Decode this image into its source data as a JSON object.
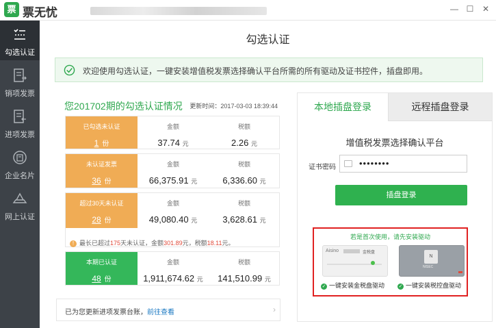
{
  "app": {
    "logo_char": "票",
    "title": "票无忧",
    "minimize": "—",
    "maximize": "☐",
    "close": "✕"
  },
  "sidebar": {
    "items": [
      {
        "label": "勾选认证",
        "icon": "check-list-icon",
        "active": true
      },
      {
        "label": "销项发票",
        "icon": "output-invoice-icon",
        "active": false
      },
      {
        "label": "进项发票",
        "icon": "input-invoice-icon",
        "active": false
      },
      {
        "label": "企业名片",
        "icon": "company-card-icon",
        "active": false
      },
      {
        "label": "网上认证",
        "icon": "online-auth-icon",
        "active": false
      }
    ]
  },
  "main": {
    "title": "勾选认证",
    "notice": "欢迎使用勾选认证，一键安装增值税发票选择确认平台所需的所有驱动及证书控件，插盘即用。"
  },
  "stats": {
    "title": "您201702期的勾选认证情况",
    "update_time": "更新时间：2017-03-03 18:39:44",
    "col_amount": "金额",
    "col_tax": "税额",
    "unit_yuan": "元",
    "unit_fen": "份",
    "rows": [
      {
        "label": "已勾选未认证",
        "count": "1",
        "amount": "37.74",
        "tax": "2.26",
        "color": "#f0ac55"
      },
      {
        "label": "未认证发票",
        "count": "36",
        "amount": "66,375.91",
        "tax": "6,336.60",
        "color": "#f0ac55"
      },
      {
        "label": "超过30天未认证",
        "count": "28",
        "amount": "49,080.40",
        "tax": "3,628.61",
        "color": "#f0ac55"
      },
      {
        "label": "本期已认证",
        "count": "48",
        "amount": "1,911,674.62",
        "tax": "141,510.99",
        "color": "#34b75a"
      }
    ],
    "warning": {
      "icon": "!",
      "prefix": "最长已超过",
      "days": "175",
      "mid1": "天未认证，金额",
      "amount": "301.89",
      "mid2": "元，税额",
      "tax": "18.11",
      "suffix": "元。"
    },
    "footer_text": "已为您更新进项发票台账，",
    "footer_link": "前往查看",
    "footer_arrow": "›"
  },
  "login": {
    "tab_local": "本地插盘登录",
    "tab_remote": "远程插盘登录",
    "platform_title": "增值税发票选择确认平台",
    "password_label": "证书密码",
    "password_value": "••••••••",
    "login_button": "插盘登录",
    "driver_hint": "若是首次使用，请先安装驱动",
    "device1_brand": "Aisino",
    "device1_tag": "金税盘",
    "device1_link": "一键安装金税盘驱动",
    "device2_chip": "N",
    "device2_brand": "NISEC",
    "device2_link": "一键安装税控盘驱动",
    "link_check": "✓"
  },
  "colors": {
    "accent_green": "#2fa84f",
    "orange": "#f0ac55",
    "highlight_red": "#e02020",
    "sidebar_bg": "#3d4248"
  }
}
